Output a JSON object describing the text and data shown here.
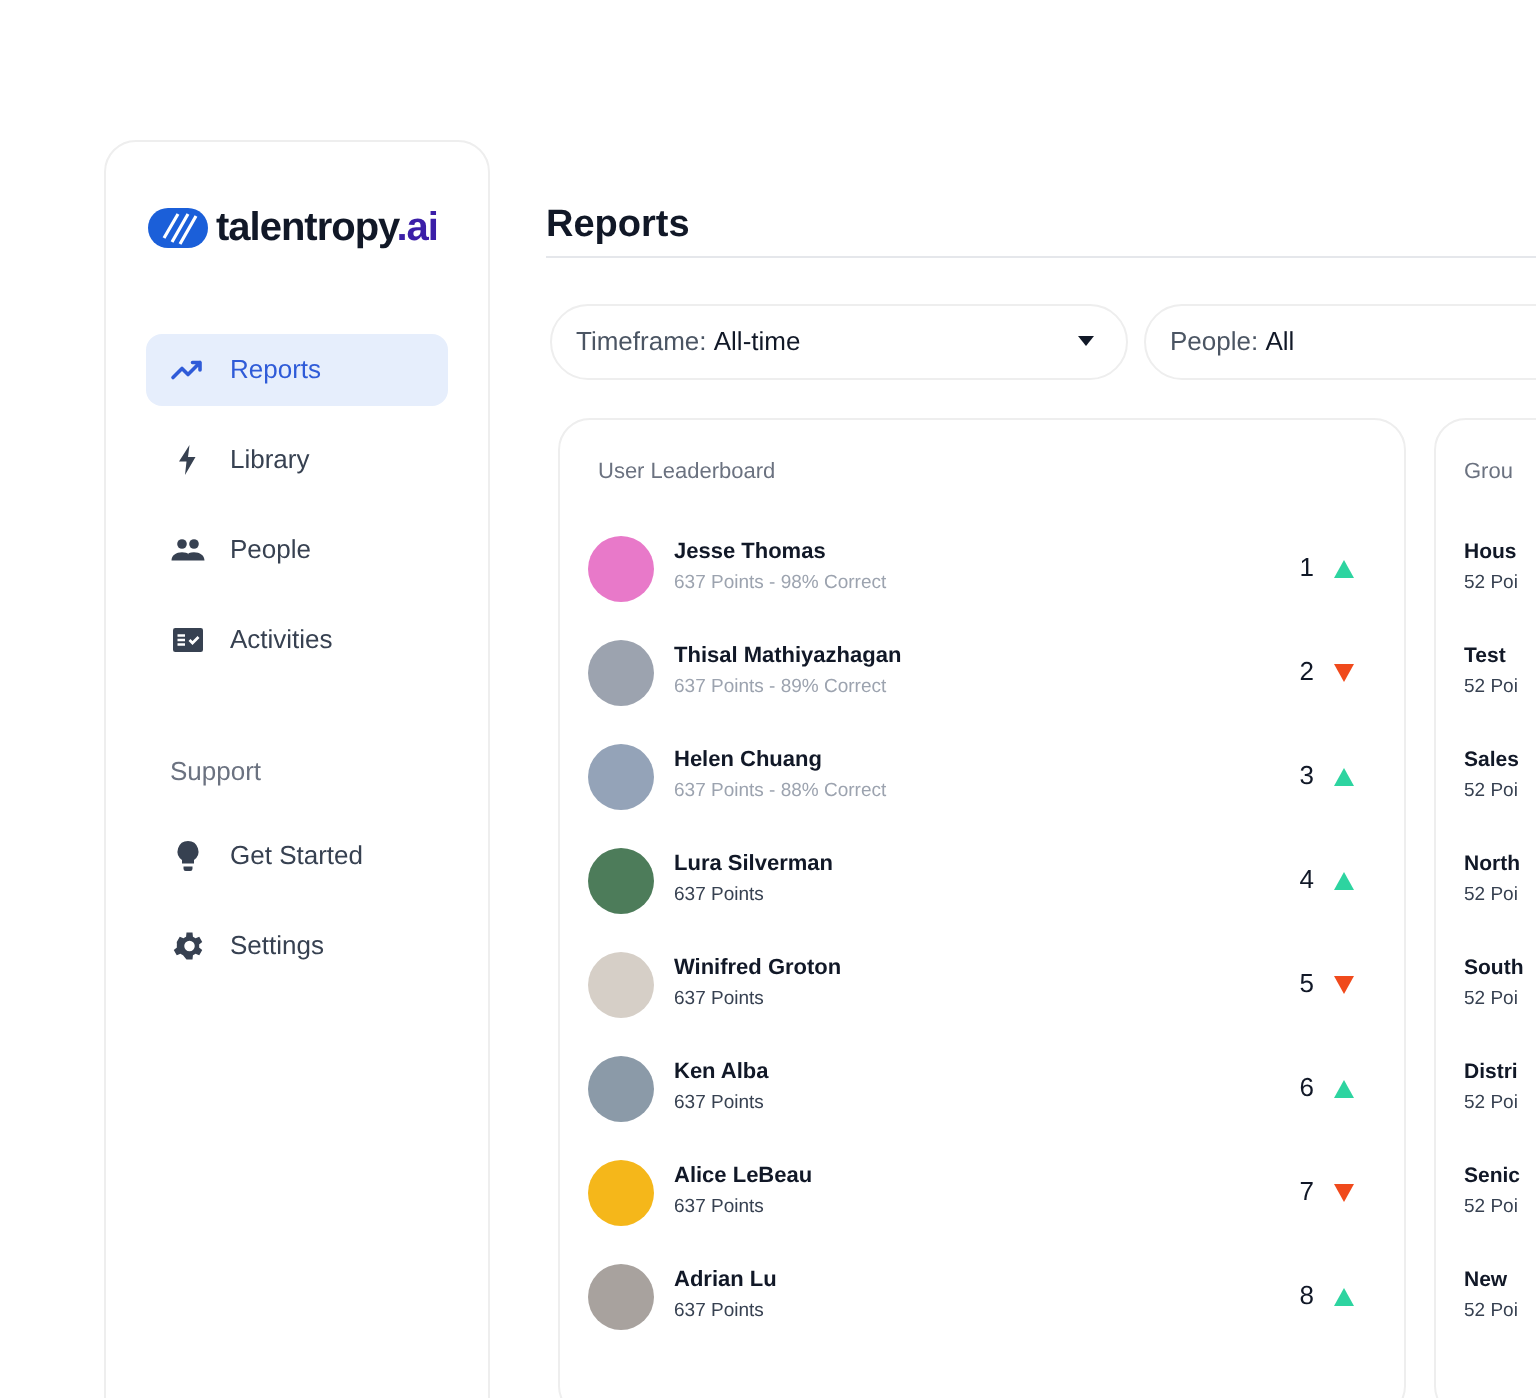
{
  "logo": {
    "name": "talentropy",
    "suffix": ".ai"
  },
  "sidebar": {
    "items": [
      {
        "label": "Reports",
        "kind": "trend",
        "selected": true
      },
      {
        "label": "Library",
        "kind": "bolt",
        "selected": false
      },
      {
        "label": "People",
        "kind": "people",
        "selected": false
      },
      {
        "label": "Activities",
        "kind": "checklist",
        "selected": false
      }
    ],
    "support_heading": "Support",
    "support_items": [
      {
        "label": "Get Started",
        "kind": "bulb",
        "selected": false
      },
      {
        "label": "Settings",
        "kind": "gear",
        "selected": false
      }
    ]
  },
  "page_title": "Reports",
  "filters": [
    {
      "label": "Timeframe:",
      "value": "All-time",
      "dropdown": true
    },
    {
      "label": "People:",
      "value": "All"
    }
  ],
  "leaderboard": {
    "title": "User Leaderboard",
    "rows": [
      {
        "name": "Jesse Thomas",
        "detail": "637 Points - 98% Correct",
        "muted": true,
        "rank": "1",
        "kind": "up",
        "color": "#e879c9"
      },
      {
        "name": "Thisal Mathiyazhagan",
        "detail": "637 Points - 89% Correct",
        "muted": true,
        "rank": "2",
        "kind": "down",
        "color": "#9ca3af"
      },
      {
        "name": "Helen Chuang",
        "detail": "637 Points - 88% Correct",
        "muted": true,
        "rank": "3",
        "kind": "up",
        "color": "#94a3b8"
      },
      {
        "name": "Lura Silverman",
        "detail": "637 Points",
        "muted": false,
        "rank": "4",
        "kind": "up",
        "color": "#4d7c5a"
      },
      {
        "name": "Winifred Groton",
        "detail": "637 Points",
        "muted": false,
        "rank": "5",
        "kind": "down",
        "color": "#d6cfc7"
      },
      {
        "name": "Ken Alba",
        "detail": "637 Points",
        "muted": false,
        "rank": "6",
        "kind": "up",
        "color": "#8b9aa8"
      },
      {
        "name": "Alice LeBeau",
        "detail": "637 Points",
        "muted": false,
        "rank": "7",
        "kind": "down",
        "color": "#f5b71a"
      },
      {
        "name": "Adrian Lu",
        "detail": "637 Points",
        "muted": false,
        "rank": "8",
        "kind": "up",
        "color": "#a8a29e"
      }
    ]
  },
  "groups": {
    "title": "Grou",
    "rows": [
      {
        "name": "Hous",
        "detail": "52 Poi"
      },
      {
        "name": "Test",
        "detail": "52 Poi"
      },
      {
        "name": "Sales",
        "detail": "52 Poi"
      },
      {
        "name": "North",
        "detail": "52 Poi"
      },
      {
        "name": "South",
        "detail": "52 Poi"
      },
      {
        "name": "Distri",
        "detail": "52 Poi"
      },
      {
        "name": "Senic",
        "detail": "52 Poi"
      },
      {
        "name": "New",
        "detail": "52 Poi"
      }
    ]
  }
}
